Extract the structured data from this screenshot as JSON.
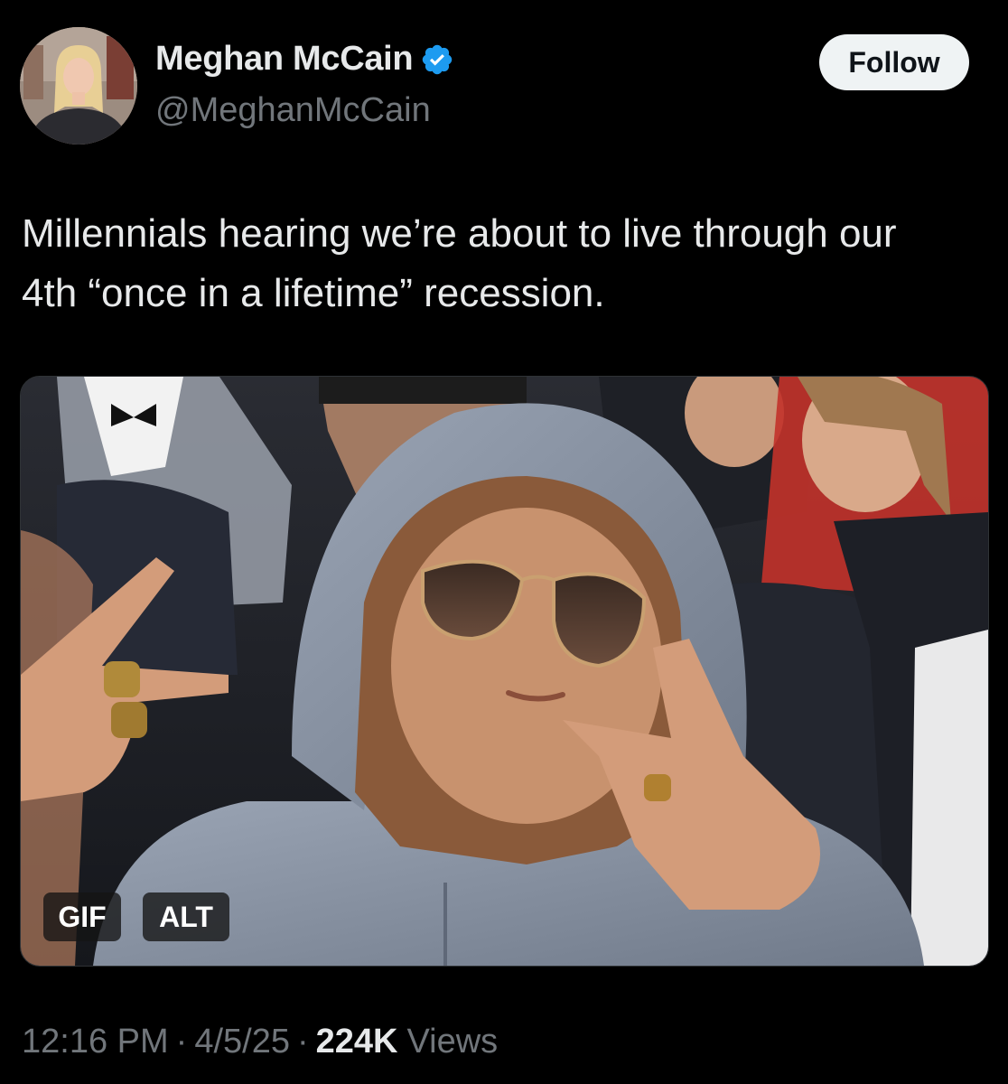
{
  "author": {
    "display_name": "Meghan McCain",
    "handle": "@MeghanMcCain",
    "verified_icon": "verified-badge-icon",
    "verified_color": "#1d9bf0"
  },
  "follow_label": "Follow",
  "tweet": {
    "text": "Millennials hearing we’re about to live through our\n4th “once in a lifetime” recession."
  },
  "media": {
    "type": "gif",
    "gif_badge": "GIF",
    "alt_badge": "ALT"
  },
  "meta": {
    "time": "12:16 PM",
    "separator": "·",
    "date": "4/5/25",
    "views_count": "224K",
    "views_label": "Views"
  },
  "colors": {
    "background": "#000000",
    "text_primary": "#e7e9ea",
    "text_secondary": "#71767b",
    "follow_button_bg": "#eff3f4"
  }
}
